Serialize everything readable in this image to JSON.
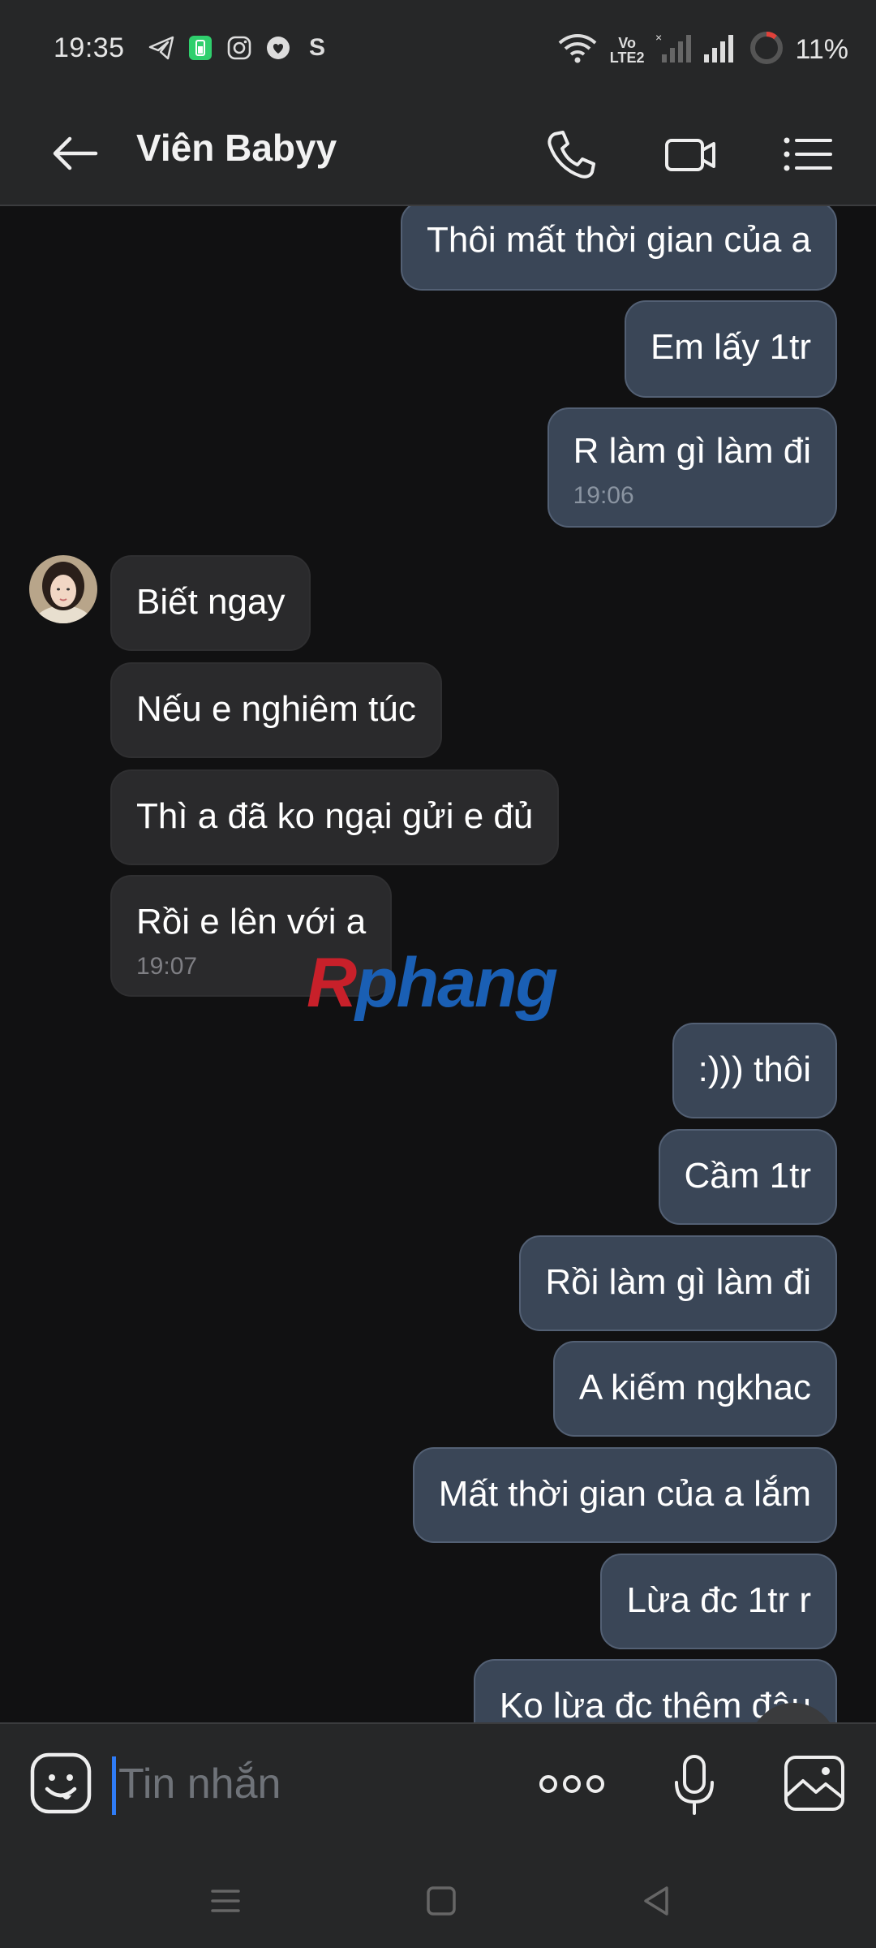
{
  "status_bar": {
    "time": "19:35",
    "battery_pct": "11%",
    "volte": "Vo\nLTE2",
    "left_icons": [
      "telegram-icon",
      "battery-saver-icon",
      "instagram-icon",
      "heart-icon",
      "skype-icon"
    ],
    "right_icons": [
      "wifi-icon",
      "volte-icon",
      "signal-off-icon",
      "signal-icon",
      "battery-icon"
    ]
  },
  "header": {
    "contact_name": "Viên Babyy",
    "icons": [
      "back-arrow-icon",
      "phone-icon",
      "video-call-icon",
      "menu-list-icon"
    ]
  },
  "messages": [
    {
      "dir": "out",
      "text": "Thôi mất thời gian của a"
    },
    {
      "dir": "out",
      "text": "Em lấy 1tr"
    },
    {
      "dir": "out",
      "text": "R làm gì làm đi",
      "time": "19:06"
    },
    {
      "dir": "in",
      "text": "Biết ngay"
    },
    {
      "dir": "in",
      "text": "Nếu e nghiêm túc"
    },
    {
      "dir": "in",
      "text": "Thì a đã ko ngại gửi e đủ"
    },
    {
      "dir": "in",
      "text": "Rồi e lên với a",
      "time": "19:07"
    },
    {
      "dir": "out",
      "text": ":))) thôi"
    },
    {
      "dir": "out",
      "text": "Cầm 1tr"
    },
    {
      "dir": "out",
      "text": "Rồi làm gì làm đi"
    },
    {
      "dir": "out",
      "text": "A kiếm ngkhac"
    },
    {
      "dir": "out",
      "text": "Mất thời gian của a lắm"
    },
    {
      "dir": "out",
      "text": "Lừa đc 1tr r"
    },
    {
      "dir": "out",
      "text": "Ko lừa đc thêm đâu"
    }
  ],
  "watermark": {
    "first": "R",
    "rest": "phang"
  },
  "composer": {
    "placeholder": "Tin nhắn",
    "icons": [
      "emoji-icon",
      "more-dots-icon",
      "microphone-icon",
      "image-icon"
    ]
  },
  "colors": {
    "background": "#111112",
    "bar": "#262728",
    "outgoing_bubble": "#3a4657",
    "incoming_bubble": "#2a2a2c",
    "caret": "#2f7cf6"
  }
}
